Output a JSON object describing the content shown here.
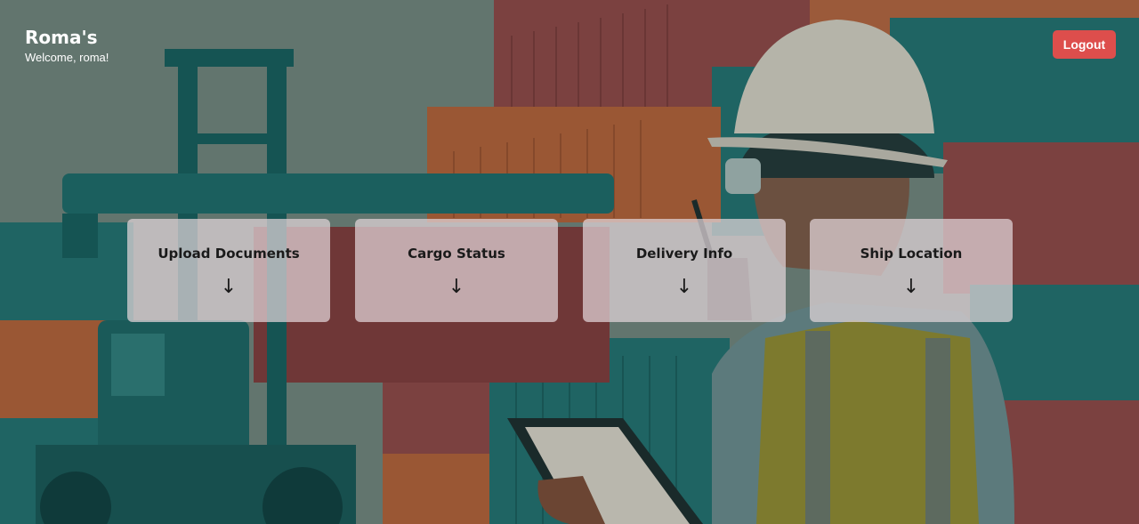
{
  "header": {
    "title": "Roma's",
    "welcome": "Welcome, roma!"
  },
  "logout": {
    "label": "Logout"
  },
  "cards": [
    {
      "title": "Upload Documents",
      "arrow": "↓"
    },
    {
      "title": "Cargo Status",
      "arrow": "↓"
    },
    {
      "title": "Delivery Info",
      "arrow": "↓"
    },
    {
      "title": "Ship Location",
      "arrow": "↓"
    }
  ],
  "colors": {
    "accent": "#dd4e4c",
    "card_bg": "#e2d6da"
  },
  "background": {
    "icon": "shipping-yard-worker-illustration"
  }
}
